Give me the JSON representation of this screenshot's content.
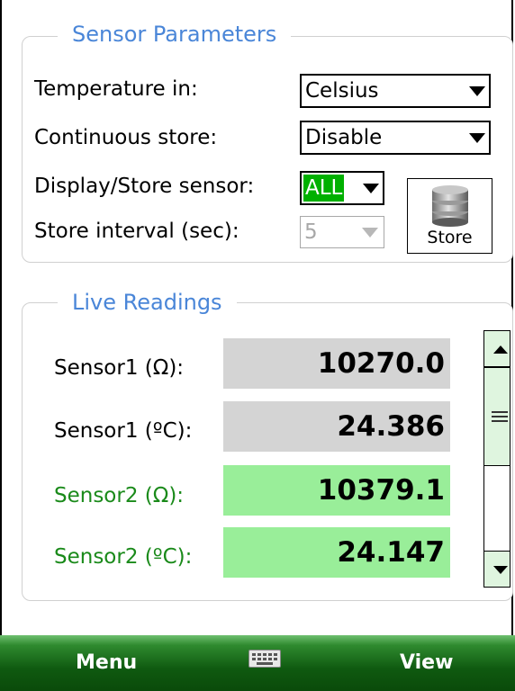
{
  "sensor_parameters": {
    "title": "Sensor Parameters",
    "temperature_label": "Temperature in:",
    "temperature_value": "Celsius",
    "continuous_label": "Continuous store:",
    "continuous_value": "Disable",
    "display_label": "Display/Store sensor:",
    "display_value": "ALL",
    "interval_label": "Store interval (sec):",
    "interval_value": "5",
    "store_label": "Store"
  },
  "live_readings": {
    "title": "Live Readings",
    "rows": [
      {
        "label": "Sensor1 (Ω):",
        "value": "10270.0"
      },
      {
        "label": "Sensor1 (ºC):",
        "value": "24.386"
      },
      {
        "label": "Sensor2 (Ω):",
        "value": "10379.1"
      },
      {
        "label": "Sensor2 (ºC):",
        "value": "24.147"
      }
    ]
  },
  "menu": {
    "left": "Menu",
    "right": "View"
  },
  "colors": {
    "title_blue": "#4a86d8",
    "sensor2_green": "#1a8a1a",
    "reading_gray": "#d4d4d4",
    "reading_green": "#99ee99",
    "selection_green": "#00b000"
  },
  "icons": [
    "database-icon",
    "keyboard-icon",
    "chevron-down-icon",
    "scroll-up-icon",
    "scroll-down-icon"
  ]
}
